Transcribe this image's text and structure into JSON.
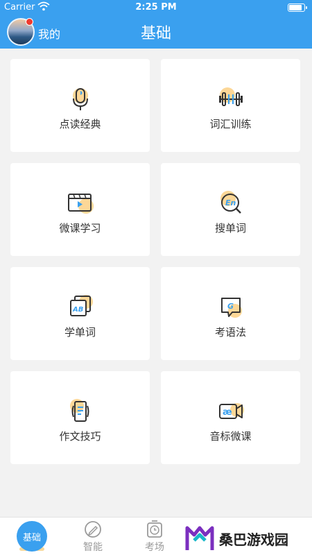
{
  "status": {
    "carrier": "Carrier",
    "time": "2:25 PM",
    "battery_level": 0.9
  },
  "header": {
    "title": "基础",
    "my_label": "我的"
  },
  "cards": [
    {
      "label": "点读经典",
      "icon": "microphone-icon"
    },
    {
      "label": "词汇训练",
      "icon": "dumbbell-icon"
    },
    {
      "label": "微课学习",
      "icon": "video-player-icon"
    },
    {
      "label": "搜单词",
      "icon": "search-en-icon"
    },
    {
      "label": "学单词",
      "icon": "ab-cards-icon"
    },
    {
      "label": "考语法",
      "icon": "grammar-chat-icon"
    },
    {
      "label": "作文技巧",
      "icon": "phone-document-icon"
    },
    {
      "label": "音标微课",
      "icon": "phonetic-camera-icon"
    }
  ],
  "tabbar": {
    "tabs": [
      {
        "label": "基础",
        "icon": "basics-icon",
        "active": true
      },
      {
        "label": "智能",
        "icon": "pencil-icon",
        "active": false
      },
      {
        "label": "考场",
        "icon": "clock-icon",
        "active": false
      }
    ]
  },
  "watermark": {
    "text": "桑巴游戏园",
    "icon": "watermark-logo-icon"
  },
  "colors": {
    "primary": "#3aa0ef",
    "accent": "#fcd797",
    "background": "#f2f2f2",
    "dark_icon": "#333333"
  }
}
